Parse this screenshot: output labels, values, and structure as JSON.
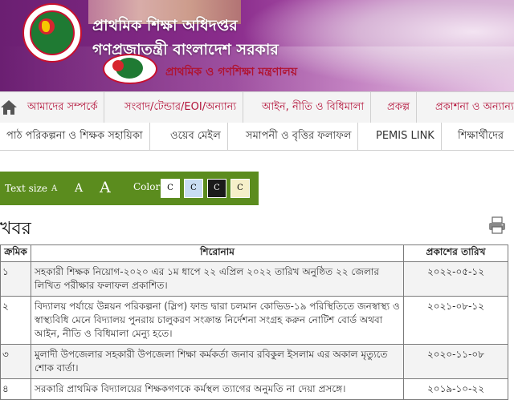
{
  "banner": {
    "title": "প্রাথমিক শিক্ষা অধিদপ্তর",
    "subtitle": "গণপ্রজাতন্ত্রী বাংলাদেশ সরকার",
    "ministry": "প্রাথমিক ও গণশিক্ষা মন্ত্রণালয়"
  },
  "menu_primary": [
    "আমাদের সম্পর্কে",
    "সংবাদ/টেন্ডার/EOI/অন্যান্য",
    "আইন, নীতি ও বিধিমালা",
    "প্রকল্প",
    "প্রকাশনা ও অন্যান্য"
  ],
  "menu_secondary": [
    "পাঠ পরিকল্পনা ও শিক্ষক সহায়িকা",
    "ওয়েব মেইল",
    "সমাপনী ও বৃত্তির ফলাফল",
    "PEMIS LINK",
    "শিক্ষার্থীদের"
  ],
  "accessibility": {
    "text_size_label": "Text size",
    "sizes": [
      "A",
      "A",
      "A"
    ],
    "color_label": "Color",
    "swatches": [
      {
        "label": "C",
        "bg": "#ffffff",
        "fg": "#000000"
      },
      {
        "label": "C",
        "bg": "#c9ddf2",
        "fg": "#000000"
      },
      {
        "label": "C",
        "bg": "#1a1a1a",
        "fg": "#ffffff"
      },
      {
        "label": "C",
        "bg": "#f5efc9",
        "fg": "#000000"
      }
    ],
    "bar_color": "#5b8c1e"
  },
  "news": {
    "heading": "খবর",
    "columns": [
      "ক্রমিক",
      "শিরোনাম",
      "প্রকাশের তারিখ"
    ],
    "rows": [
      {
        "sl": "১",
        "title": "সহকারী শিক্ষক নিয়োগ-২০২০ এর ১ম ধাপে ২২ এপ্রিল ২০২২ তারিখ অনুষ্ঠিত ২২ জেলার লিখিত পরীক্ষার ফলাফল প্রকাশিত।",
        "date": "২০২২-০৫-১২"
      },
      {
        "sl": "২",
        "title": "বিদ্যালয় পর্যায়ে উন্নয়ন পরিকল্পনা (স্লিপ) ফান্ড দ্বারা চলমান কোভিড-১৯ পরিস্থিতিতে জনস্বাস্থ্য ও স্বাস্থ্যবিধি মেনে বিদ্যালয় পুনরায় চালুকরণ সংক্রান্ত নির্দেশনা সংগ্রহ করুন নোটিশ বোর্ড অথবা আইন, নীতি ও বিধিমালা মেন্যু হতে।",
        "date": "২০২১-০৮-১২"
      },
      {
        "sl": "৩",
        "title": "মুলাদী উপজেলার সহকারী উপজেলা শিক্ষা কর্মকর্তা জনাব রবিকুল ইসলাম এর অকাল মৃত্যুতে শোক বার্তা।",
        "date": "২০২০-১১-০৮"
      },
      {
        "sl": "৪",
        "title": "সরকারি প্রাথমিক বিদ্যালয়ের শিক্ষকগণকে কর্মস্থল ত্যাগের অনুমতি না দেয়া প্রসঙ্গে।",
        "date": "২০১৯-১০-২২"
      }
    ]
  },
  "colors": {
    "menu_text": "#b3133a",
    "banner_purple": "#8a2c8c",
    "ministry_text": "#b01330"
  }
}
